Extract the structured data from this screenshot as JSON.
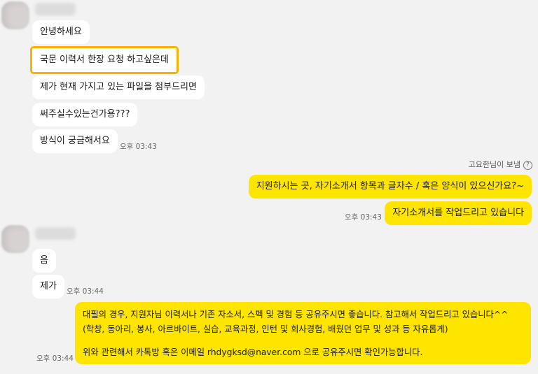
{
  "thread": {
    "incoming_1": [
      "안녕하세요",
      "국문 이력서 한장 요청 하고싶은데",
      "제가 현재 가지고 있는 파일을 첨부드리면",
      "써주실수있는건가용???",
      "방식이 궁금해서요"
    ],
    "incoming_1_time": "오후 03:43",
    "reply_tag": "고요한님이 보냄",
    "outgoing_1": [
      "지원하시는 곳, 자기소개서 항목과 글자수 / 혹은 양식이 있으신가요?~",
      "자기소개서를 작업드리고 있습니다"
    ],
    "outgoing_1_time": "오후 03:43",
    "incoming_2": [
      "음",
      "제가"
    ],
    "incoming_2_time": "오후 03:44",
    "outgoing_2": {
      "line1": "대필의 경우, 지원자님 이력서나 기존 자소서, 스펙 및 경험 등 공유주시면 좋습니다. 참고해서 작업드리고 있습니다^^",
      "line2": "(학창, 동아리, 봉사, 아르바이트, 실습, 교육과정, 인턴 및 회사경험, 배웠던 업무 및 성과 등 자유롭게)",
      "line3": "위와 관련해서 카톡방 혹은 이메일 rhdygksd@naver.com 으로 공유주시면 확인가능합니다."
    },
    "outgoing_2_time": "오후 03:44"
  },
  "colors": {
    "background": "#f2f2f2",
    "incoming_bubble": "#ffffff",
    "outgoing_bubble": "#fee500",
    "highlight_border": "#f4b400"
  }
}
